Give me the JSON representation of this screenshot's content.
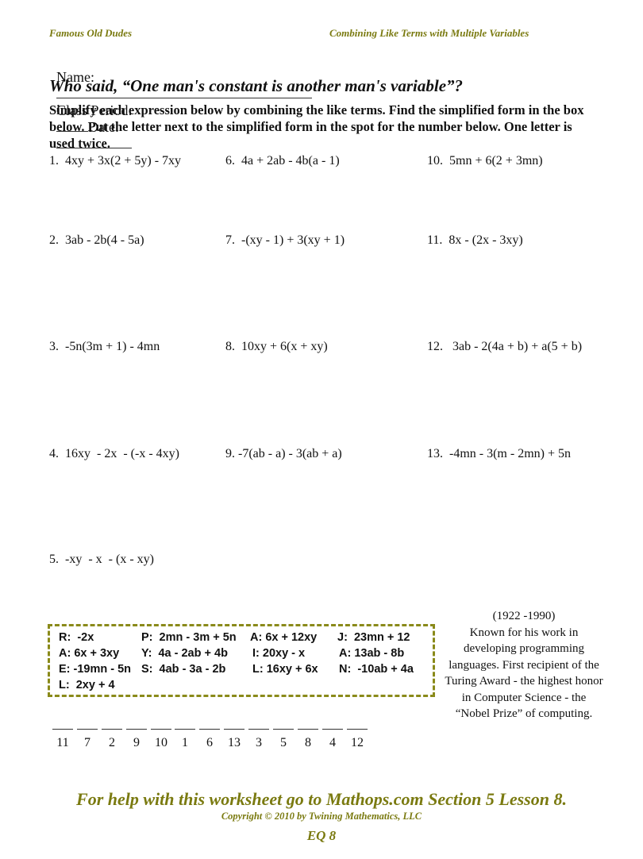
{
  "header": {
    "left_title": "Famous Old Dudes",
    "right_title": "Combining Like Terms with Multiple Variables"
  },
  "form": {
    "name_label": "Name:",
    "class_period_label": "Class Period:",
    "date_label": "Date:"
  },
  "question": "Who said, “One man's constant is another man's variable”?",
  "instructions": "Simplify each expression below by combining the like terms.  Find the simplified form in the box below.  Put the letter next to the simplified form in the spot for the number below.  One letter is used twice.",
  "problems": [
    {
      "num": "1.",
      "expr": "4xy + 3x(2 + 5y) - 7xy"
    },
    {
      "num": "2.",
      "expr": "3ab - 2b(4 - 5a)"
    },
    {
      "num": "3.",
      "expr": "-5n(3m + 1) - 4mn"
    },
    {
      "num": "4.",
      "expr": "16xy  - 2x  - (-x - 4xy)"
    },
    {
      "num": "5.",
      "expr": "-xy  - x  - (x - xy)"
    },
    {
      "num": "6.",
      "expr": "4a + 2ab - 4b(a - 1)"
    },
    {
      "num": "7.",
      "expr": "-(xy - 1) + 3(xy + 1)"
    },
    {
      "num": "8.",
      "expr": "10xy + 6(x + xy)"
    },
    {
      "num": "9.",
      "expr": "-7(ab - a) - 3(ab + a)"
    },
    {
      "num": "10.",
      "expr": "5mn + 6(2 + 3mn)"
    },
    {
      "num": "11.",
      "expr": "8x - (2x - 3xy)"
    },
    {
      "num": "12.",
      "expr": "3ab - 2(4a + b) + a(5 + b)"
    },
    {
      "num": "13.",
      "expr": "-4mn - 3(m - 2mn) + 5n"
    }
  ],
  "answer_key": [
    [
      "R:  -2x",
      "P:  2mn - 3m + 5n",
      "A: 6x + 12xy",
      "J:  23mn + 12"
    ],
    [
      "A: 6x + 3xy",
      "Y:  4a - 2ab + 4b",
      "I: 20xy - x",
      "A: 13ab - 8b"
    ],
    [
      "E: -19mn - 5n",
      "S:  4ab - 3a - 2b",
      "L: 16xy + 6x",
      "N:  -10ab + 4a"
    ],
    [
      "L:  2xy + 4"
    ]
  ],
  "bio": {
    "years": "(1922 -1990)",
    "text": "Known for his work in developing programming languages. First recipient of the Turing Award - the highest honor in Computer Science - the “Nobel Prize” of computing."
  },
  "answer_slots": [
    "11",
    "7",
    "2",
    "9",
    "10",
    "1",
    "6",
    "13",
    "3",
    "5",
    "8",
    "4",
    "12"
  ],
  "footer": {
    "help": "For help with this worksheet go to Mathops.com Section 5 Lesson 8.",
    "copyright": "Copyright © 2010 by Twining Mathematics, LLC",
    "code": "EQ 8"
  },
  "colors": {
    "accent_olive": "#7a7a10",
    "box_border": "#8a8a1a"
  }
}
